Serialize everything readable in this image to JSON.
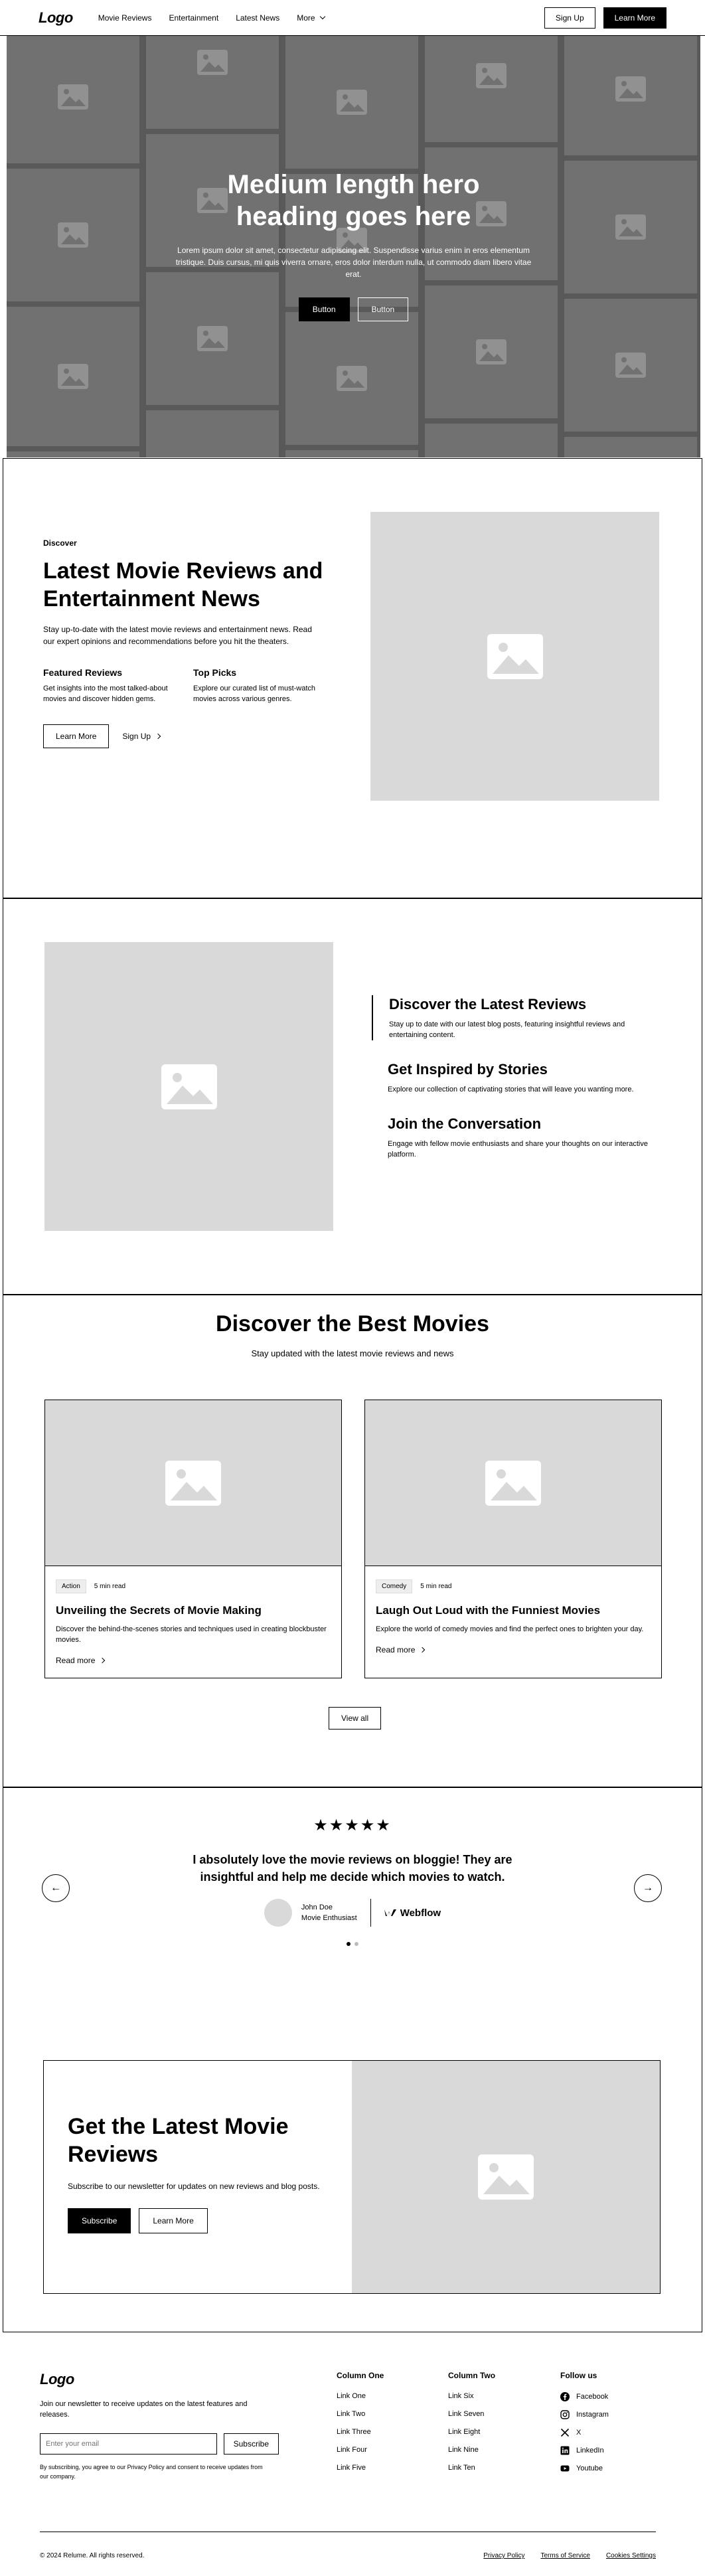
{
  "nav": {
    "logo": "Logo",
    "links": [
      {
        "label": "Movie Reviews"
      },
      {
        "label": "Entertainment"
      },
      {
        "label": "Latest News"
      },
      {
        "label": "More"
      }
    ],
    "signup": "Sign Up",
    "learn_more": "Learn More"
  },
  "hero": {
    "heading": "Medium length hero heading goes here",
    "body": "Lorem ipsum dolor sit amet, consectetur adipiscing elit. Suspendisse varius enim in eros elementum tristique. Duis cursus, mi quis viverra ornare, eros dolor interdum nulla, ut commodo diam libero vitae erat.",
    "button_primary": "Button",
    "button_secondary": "Button"
  },
  "about": {
    "eyebrow": "Discover",
    "heading": "Latest Movie Reviews and Entertainment News",
    "lead": "Stay up-to-date with the latest movie reviews and entertainment news. Read our expert opinions and recommendations before you hit the theaters.",
    "features": [
      {
        "title": "Featured Reviews",
        "body": "Get insights into the most talked-about movies and discover hidden gems."
      },
      {
        "title": "Top Picks",
        "body": "Explore our curated list of must-watch movies across various genres."
      }
    ],
    "learn_more": "Learn More",
    "signup": "Sign Up"
  },
  "tabs": {
    "items": [
      {
        "title": "Discover the Latest Reviews",
        "body": "Stay up to date with our latest blog posts, featuring insightful reviews and entertaining content."
      },
      {
        "title": "Get Inspired by Stories",
        "body": "Explore our collection of captivating stories that will leave you wanting more."
      },
      {
        "title": "Join the Conversation",
        "body": "Engage with fellow movie enthusiasts and share your thoughts on our interactive platform."
      }
    ]
  },
  "blog": {
    "heading": "Discover the Best Movies",
    "subheading": "Stay updated with the latest movie reviews and news",
    "cards": [
      {
        "tag": "Action",
        "read_time": "5 min read",
        "title": "Unveiling the Secrets of Movie Making",
        "body": "Discover the behind-the-scenes stories and techniques used in creating blockbuster movies.",
        "link": "Read more"
      },
      {
        "tag": "Comedy",
        "read_time": "5 min read",
        "title": "Laugh Out Loud with the Funniest Movies",
        "body": "Explore the world of comedy movies and find the perfect ones to brighten your day.",
        "link": "Read more"
      }
    ],
    "view_all": "View all"
  },
  "testimonial": {
    "stars": "★★★★★",
    "rating": 5,
    "quote": "I absolutely love the movie reviews on bloggie! They are insightful and help me decide which movies to watch.",
    "name": "John Doe",
    "role": "Movie Enthusiast",
    "company": "Webflow",
    "prev": "←",
    "next": "→"
  },
  "cta": {
    "heading": "Get the Latest Movie Reviews",
    "body": "Subscribe to our newsletter for updates on new reviews and blog posts.",
    "subscribe": "Subscribe",
    "learn_more": "Learn More"
  },
  "footer": {
    "logo": "Logo",
    "newsletter_text": "Join our newsletter to receive updates on the latest features and releases.",
    "email_placeholder": "Enter your email",
    "subscribe": "Subscribe",
    "privacy_note": "By subscribing, you agree to our Privacy Policy and consent to receive updates from our company.",
    "col1": {
      "title": "Column One",
      "links": [
        "Link One",
        "Link Two",
        "Link Three",
        "Link Four",
        "Link Five"
      ]
    },
    "col2": {
      "title": "Column Two",
      "links": [
        "Link Six",
        "Link Seven",
        "Link Eight",
        "Link Nine",
        "Link Ten"
      ]
    },
    "social": {
      "title": "Follow us",
      "links": [
        "Facebook",
        "Instagram",
        "X",
        "LinkedIn",
        "Youtube"
      ]
    },
    "copyright": "© 2024 Relume. All rights reserved.",
    "legal": [
      "Privacy Policy",
      "Terms of Service",
      "Cookies Settings"
    ]
  }
}
